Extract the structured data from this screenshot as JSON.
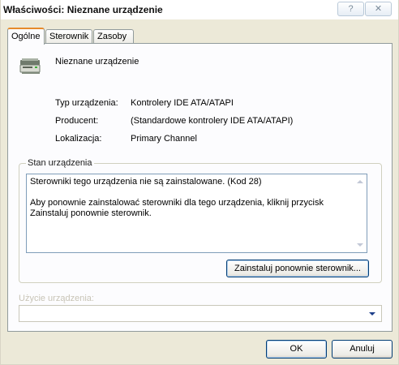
{
  "window": {
    "title": "Właściwości: Nieznane urządzenie",
    "help_button": "?",
    "close_button": "✕"
  },
  "tabs": [
    {
      "label": "Ogólne",
      "active": true
    },
    {
      "label": "Sterownik",
      "active": false
    },
    {
      "label": "Zasoby",
      "active": false
    }
  ],
  "device": {
    "icon": "unknown-device-icon",
    "name": "Nieznane urządzenie"
  },
  "properties": [
    {
      "label": "Typ urządzenia:",
      "value": "Kontrolery IDE ATA/ATAPI"
    },
    {
      "label": "Producent:",
      "value": "(Standardowe kontrolery IDE ATA/ATAPI)"
    },
    {
      "label": "Lokalizacja:",
      "value": "Primary Channel"
    }
  ],
  "status_group": {
    "label": "Stan urządzenia",
    "text": "Sterowniki tego urządzenia nie są zainstalowane. (Kod 28)\n\nAby ponownie zainstalować sterowniki dla tego urządzenia, kliknij przycisk\nZainstaluj ponownie sterownik.",
    "reinstall_button": "Zainstaluj ponownie sterownik..."
  },
  "usage": {
    "label": "Użycie urządzenia:",
    "selected": "",
    "enabled": false
  },
  "buttons": {
    "ok": "OK",
    "cancel": "Anuluj"
  }
}
